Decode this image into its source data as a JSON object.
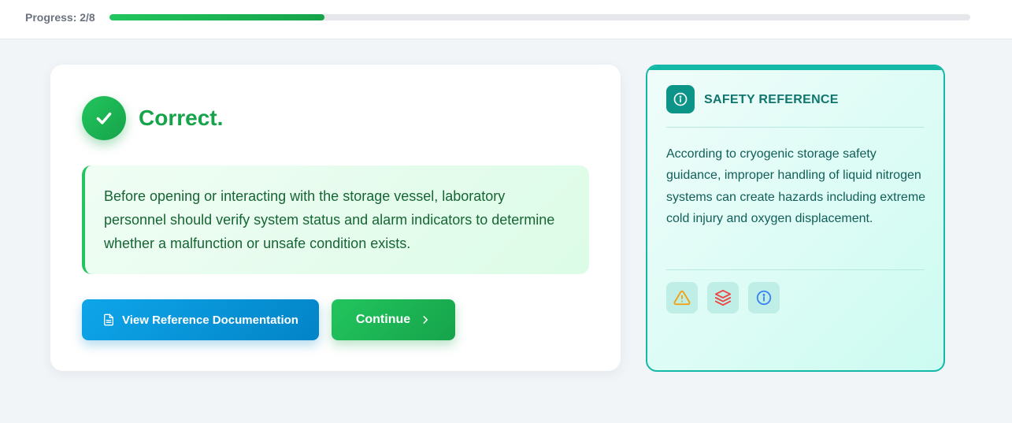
{
  "progress": {
    "label": "Progress: 2/8",
    "fraction": 0.25
  },
  "result": {
    "title": "Correct.",
    "icon": "check-icon",
    "explanation": "Before opening or interacting with the storage vessel, laboratory personnel should verify system status and alarm indicators to determine whether a malfunction or unsafe condition exists."
  },
  "actions": {
    "reference_label": "View Reference Documentation",
    "reference_icon": "document-icon",
    "continue_label": "Continue",
    "continue_icon": "chevron-right-icon"
  },
  "safety": {
    "title": "SAFETY REFERENCE",
    "header_icon": "info-icon",
    "text": "According to cryogenic storage safety guidance, improper handling of liquid nitrogen systems can create hazards including extreme cold injury and oxygen displacement.",
    "icons": [
      "warning-icon",
      "layers-icon",
      "info-icon"
    ]
  },
  "colors": {
    "success": "#16a34a",
    "primary": "#0284c7",
    "teal": "#0d9488",
    "warning": "#f59e0b",
    "danger": "#ef4444",
    "info": "#3b82f6"
  }
}
